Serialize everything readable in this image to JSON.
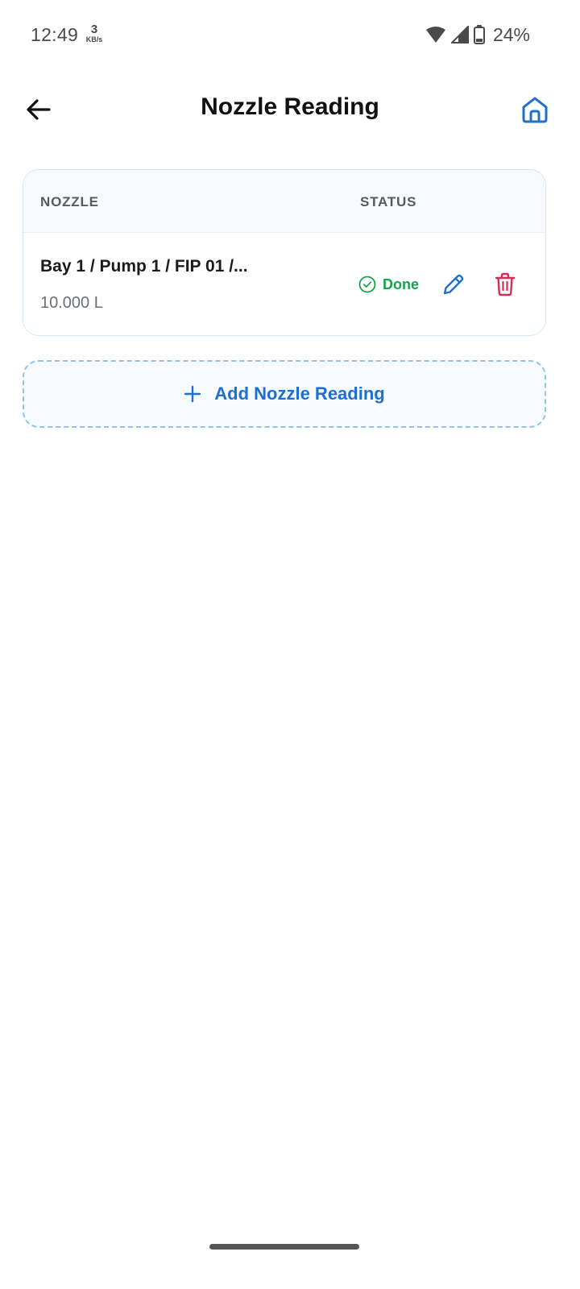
{
  "status_bar": {
    "time": "12:49",
    "net_speed_value": "3",
    "net_speed_unit": "KB/s",
    "battery": "24%"
  },
  "app_bar": {
    "title": "Nozzle Reading"
  },
  "table": {
    "columns": {
      "nozzle": "NOZZLE",
      "status": "STATUS"
    },
    "rows": [
      {
        "name": "Bay 1 / Pump 1 / FIP 01 /...",
        "reading": "10.000 L",
        "status": "Done"
      }
    ]
  },
  "add_button": {
    "label": "Add Nozzle Reading"
  },
  "colors": {
    "accent": "#1e6fd0",
    "success": "#16a34a",
    "danger": "#d62b53",
    "card_border": "#d6e6f6"
  },
  "icons": {
    "back": "arrow-left-icon",
    "home": "home-icon",
    "status": "check-circle-icon",
    "edit": "pencil-icon",
    "delete": "trash-icon",
    "add": "plus-icon"
  }
}
